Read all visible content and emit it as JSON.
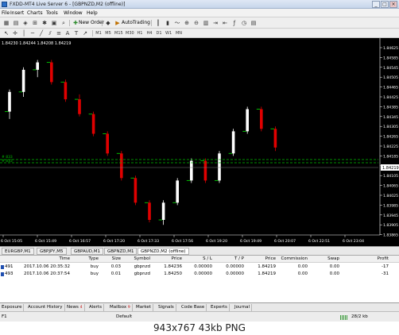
{
  "window": {
    "title": "FXDD-MT4 Live Server 6 - [GBPNZD,M2 (offline)]",
    "controls": [
      "_",
      "□",
      "×"
    ]
  },
  "menu": [
    "File",
    "Insert",
    "Charts",
    "Tools",
    "Window",
    "Help"
  ],
  "toolbar": {
    "new_order": "New Order",
    "autotrading": "AutoTrading"
  },
  "chart": {
    "symbol": "GBPNZD,M2 (offline)",
    "colors": {
      "background": "#000000",
      "bull": "#ffffff",
      "bear": "#e00000",
      "ma": "#00d000",
      "grid_level": "#00c000",
      "axis_text": "#ffffff"
    },
    "price_labels": [
      "1.84625",
      "1.84585",
      "1.84545",
      "1.84505",
      "1.84465",
      "1.84425",
      "1.84385",
      "1.84345",
      "1.84305",
      "1.84265",
      "1.84225",
      "1.84185",
      "1.84145",
      "1.84105",
      "1.84065",
      "1.84025",
      "1.83985",
      "1.83945",
      "1.83905",
      "1.83865"
    ],
    "current_price": "1.84219",
    "ohlc_header": "1.84230 1.84244 1.84208 1.84219",
    "level_labels": [
      "# 833",
      "# 833"
    ],
    "time_labels": [
      "6 Oct 15:05",
      "6 Oct 15:49",
      "6 Oct 16:57",
      "6 Oct 17:20",
      "6 Oct 17:33",
      "6 Oct 17:56",
      "6 Oct 19:20",
      "6 Oct 19:49",
      "6 Oct 20:07",
      "6 Oct 22:51",
      "6 Oct 23:04"
    ]
  },
  "chart_tabs": [
    "EURGBP,M1",
    "GBPJPY,M5",
    "GBPAUD,M1",
    "GBPNZD,M1",
    "GBPNZD,M2 (offline)"
  ],
  "terminal": {
    "headers": [
      "Time",
      "Type",
      "Size",
      "Symbol",
      "Price",
      "S / L",
      "T / P",
      "Price",
      "Commission",
      "Swap",
      "Profit"
    ],
    "rows": [
      {
        "id": "491",
        "time": "2017.10.06 20:35:32",
        "type": "buy",
        "size": "0.03",
        "symbol": "gbpnzd",
        "price": "1.84236",
        "sl": "0.00000",
        "tp": "0.00000",
        "cur": "1.84219",
        "commission": "0.00",
        "swap": "0.00",
        "profit": "-17"
      },
      {
        "id": "493",
        "time": "2017.10.06 20:37:54",
        "type": "buy",
        "size": "0.01",
        "symbol": "gbpnzd",
        "price": "1.84250",
        "sl": "0.00000",
        "tp": "0.00000",
        "cur": "1.84219",
        "commission": "0.00",
        "swap": "0.00",
        "profit": "-31"
      }
    ]
  },
  "bottom_tabs": [
    {
      "label": "Exposure",
      "count": ""
    },
    {
      "label": "Account History",
      "count": ""
    },
    {
      "label": "News",
      "count": "4"
    },
    {
      "label": "Alerts",
      "count": ""
    },
    {
      "label": "Mailbox",
      "count": "9"
    },
    {
      "label": "Market",
      "count": ""
    },
    {
      "label": "Signals",
      "count": ""
    },
    {
      "label": "Code Base",
      "count": ""
    },
    {
      "label": "Experts",
      "count": ""
    },
    {
      "label": "Journal",
      "count": ""
    }
  ],
  "status": {
    "help": "F1",
    "profile": "Default",
    "traffic": "28/2 kb"
  },
  "footer_caption": "943x767  43kb  PNG"
}
